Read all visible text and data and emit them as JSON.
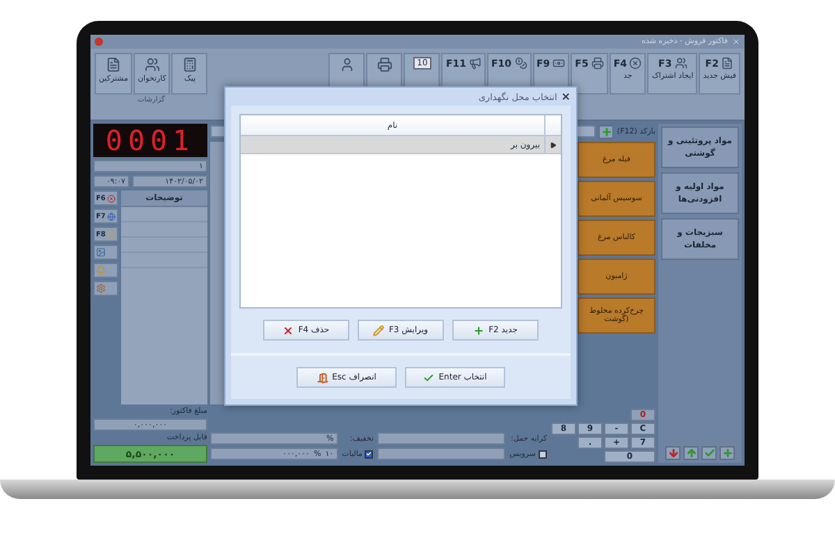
{
  "app": {
    "title": "فاکتور فروش - ذخیره شده"
  },
  "toolbar": [
    {
      "kind": "fkey",
      "key": "F2",
      "caption": "فیش جدید"
    },
    {
      "kind": "fkey",
      "key": "F3",
      "caption": "ایجاد اشتراک"
    },
    {
      "kind": "fkey",
      "key": "F4",
      "caption": "جد"
    },
    {
      "kind": "fkey",
      "key": "F5"
    },
    {
      "kind": "fkey",
      "key": "F9"
    },
    {
      "kind": "fkey",
      "key": "F10"
    },
    {
      "kind": "fkey",
      "key": "F11"
    },
    {
      "kind": "spinner",
      "value": "10"
    },
    {
      "kind": "icon"
    },
    {
      "kind": "icon"
    },
    {
      "kind": "tool",
      "caption": "پیک"
    },
    {
      "kind": "tool",
      "caption": "کارتخوان"
    },
    {
      "kind": "tool",
      "caption": "مشترکین"
    }
  ],
  "toolbar_group": "گزارشات",
  "left_panel": {
    "display": "0001",
    "counter": "۱",
    "date": "۱۴۰۲/۰۵/۰۲",
    "time": "۰۹:۰۷",
    "grid_header": "توضیحات",
    "side_buttons": [
      "F6",
      "F7",
      "F8"
    ],
    "invoice_label": "مبلغ فاکتور:",
    "invoice_value": "۰,۰۰۰,۰۰۰",
    "payable_label": "قابل پرداخت",
    "payable_value": "۵,۵۰۰,۰۰۰"
  },
  "search": {
    "label": "بارکد (F12)"
  },
  "categories": [
    "مواد پروتئینی و گوشتی",
    "مواد اولیه و افزودنی‌ها",
    "سبزیجات و مخلفات"
  ],
  "products": [
    "فیله مرغ",
    "سوسیس آلمانی",
    "کالباس مرغ",
    "ژامبون",
    "چرخ‌کرده مخلوط (گوشت"
  ],
  "numpad": [
    {
      "kind": "accent",
      "label": "0"
    },
    {
      "kind": "side",
      "label": "C"
    },
    {
      "kind": "key",
      "label": "-"
    },
    {
      "kind": "key",
      "label": "9"
    },
    {
      "kind": "key",
      "label": "8"
    },
    {
      "kind": "key",
      "label": "7"
    },
    {
      "kind": "key",
      "label": "+"
    },
    {
      "kind": "key",
      "label": "."
    },
    {
      "kind": "wide",
      "label": "0"
    }
  ],
  "totals": {
    "shipping_label": "کرایه حمل:",
    "discount_label": "تخفیف:",
    "discount_unit": "%",
    "service_label": "سرویس",
    "service_checked": false,
    "tax_label": "مالیات",
    "tax_checked": true,
    "tax_percent": "۱۰",
    "tax_unit": "%",
    "tax_amount": "۰۰۰,۰۰۰"
  },
  "dialog": {
    "title": "انتخاب محل نگهداری",
    "close": "×",
    "column": "نام",
    "rows": [
      {
        "name": "بیرون بر",
        "selected": true
      }
    ],
    "actions": [
      {
        "kind": "add",
        "label": "جدید F2"
      },
      {
        "kind": "edit",
        "label": "ویرایش F3"
      },
      {
        "kind": "delete",
        "label": "حذف F4"
      }
    ],
    "footer": [
      {
        "kind": "ok",
        "label": "انتخاب Enter"
      },
      {
        "kind": "cancel",
        "label": "انصراف Esc"
      }
    ]
  }
}
